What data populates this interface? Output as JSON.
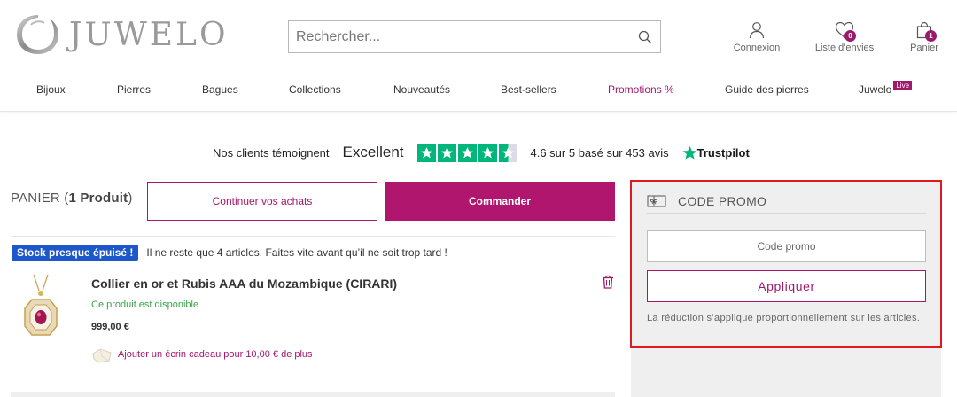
{
  "brand": {
    "name": "JUWELO"
  },
  "search": {
    "placeholder": "Rechercher..."
  },
  "header_icons": {
    "account": {
      "label": "Connexion",
      "icon": "user-icon"
    },
    "wishlist": {
      "label": "Liste d'envies",
      "count": "0",
      "icon": "heart-icon"
    },
    "cart": {
      "label": "Panier",
      "count": "1",
      "icon": "shopping-bag-icon"
    }
  },
  "nav": {
    "items": [
      "Bijoux",
      "Pierres",
      "Bagues",
      "Collections",
      "Nouveautés",
      "Best-sellers",
      "Promotions %",
      "Guide des pierres",
      "Juwelo"
    ],
    "live_badge": "Live"
  },
  "trustpilot": {
    "lead": "Nos clients témoignent",
    "rating_word": "Excellent",
    "stars": 4.5,
    "summary": "4.6 sur 5 basé sur 453 avis",
    "brand": "Trustpilot",
    "color": "#00b67a"
  },
  "cart": {
    "title": "PANIER",
    "count_text": "1 Produit",
    "continue_label": "Continuer vos achats",
    "order_label": "Commander"
  },
  "item": {
    "stock_badge": "Stock presque épuisé !",
    "stock_message": "Il ne reste que 4 articles. Faites vite avant qu’il ne soit trop tard !",
    "name": "Collier en or et Rubis AAA du Mozambique (CIRARI)",
    "availability": "Ce produit est disponible",
    "price": "999,00 €",
    "gift_offer": "Ajouter un écrin cadeau pour 10,00 € de plus"
  },
  "promo": {
    "title": "CODE PROMO",
    "input_placeholder": "Code promo",
    "apply_label": "Appliquer",
    "note": "La réduction s’applique proportionnellement sur les articles."
  },
  "colors": {
    "accent": "#a3176d",
    "order_button": "#b0166e",
    "stock_badge": "#1c58c9",
    "available": "#3aa64a",
    "highlight": "#e0191e"
  }
}
